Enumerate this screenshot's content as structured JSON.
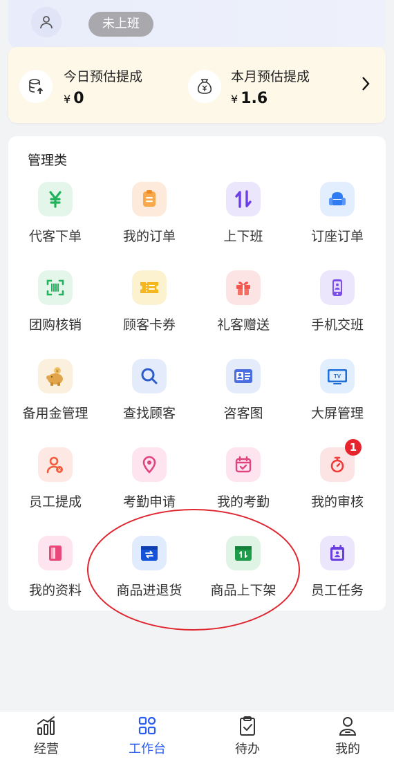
{
  "header": {
    "status_label": "未上班"
  },
  "commission": {
    "today": {
      "label": "今日预估提成",
      "currency": "¥",
      "value": "0"
    },
    "month": {
      "label": "本月预估提成",
      "currency": "¥",
      "value": "1.6"
    }
  },
  "management": {
    "title": "管理类",
    "items": [
      {
        "label": "代客下单",
        "icon": "yuan-icon"
      },
      {
        "label": "我的订单",
        "icon": "clipboard-icon"
      },
      {
        "label": "上下班",
        "icon": "up-down-arrows-icon"
      },
      {
        "label": "订座订单",
        "icon": "armchair-icon"
      },
      {
        "label": "团购核销",
        "icon": "barcode-scan-icon"
      },
      {
        "label": "顾客卡券",
        "icon": "ticket-icon"
      },
      {
        "label": "礼客赠送",
        "icon": "gift-icon"
      },
      {
        "label": "手机交班",
        "icon": "phone-icon"
      },
      {
        "label": "备用金管理",
        "icon": "piggy-bank-icon"
      },
      {
        "label": "查找顾客",
        "icon": "search-icon"
      },
      {
        "label": "咨客图",
        "icon": "id-card-icon"
      },
      {
        "label": "大屏管理",
        "icon": "tv-icon"
      },
      {
        "label": "员工提成",
        "icon": "person-yuan-icon"
      },
      {
        "label": "考勤申请",
        "icon": "location-pin-icon"
      },
      {
        "label": "我的考勤",
        "icon": "calendar-check-icon"
      },
      {
        "label": "我的审核",
        "icon": "stopwatch-icon",
        "badge": "1"
      },
      {
        "label": "我的资料",
        "icon": "profile-book-icon"
      },
      {
        "label": "商品进退货",
        "icon": "box-exchange-icon"
      },
      {
        "label": "商品上下架",
        "icon": "box-updown-icon"
      },
      {
        "label": "员工任务",
        "icon": "task-calendar-icon"
      }
    ]
  },
  "tabbar": {
    "tabs": [
      {
        "label": "经营",
        "icon": "bar-chart-icon"
      },
      {
        "label": "工作台",
        "icon": "grid-icon"
      },
      {
        "label": "待办",
        "icon": "clipboard-check-icon"
      },
      {
        "label": "我的",
        "icon": "user-icon"
      }
    ],
    "active": "工作台"
  },
  "colors": {
    "accent": "#2b5cf2",
    "badge": "#e8232e",
    "annotation": "#e0242e"
  }
}
